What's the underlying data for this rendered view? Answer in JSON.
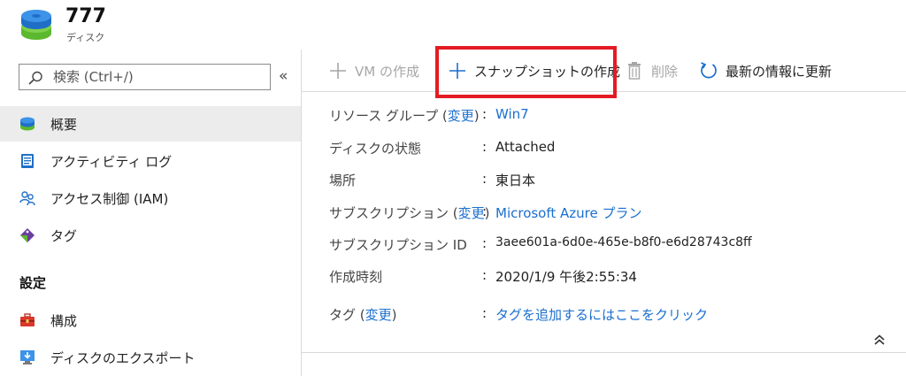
{
  "resource": {
    "title": "777",
    "subtitle": "ディスク"
  },
  "search": {
    "placeholder": "検索 (Ctrl+/)",
    "collapse_symbol": "«"
  },
  "sidebar": {
    "items": [
      {
        "label": "概要",
        "icon": "disk-icon"
      },
      {
        "label": "アクティビティ ログ",
        "icon": "activity-log-icon"
      },
      {
        "label": "アクセス制御 (IAM)",
        "icon": "people-icon"
      },
      {
        "label": "タグ",
        "icon": "tag-icon"
      }
    ],
    "section_title": "設定",
    "settings_items": [
      {
        "label": "構成",
        "icon": "toolbox-icon"
      },
      {
        "label": "ディスクのエクスポート",
        "icon": "export-monitor-icon"
      }
    ]
  },
  "toolbar": {
    "create_vm": "VM の作成",
    "create_snapshot": "スナップショットの作成",
    "delete": "削除",
    "refresh": "最新の情報に更新"
  },
  "properties": {
    "resource_group": {
      "label": "リソース グループ",
      "change": "変更",
      "value": "Win7"
    },
    "disk_state": {
      "label": "ディスクの状態",
      "value": "Attached"
    },
    "location": {
      "label": "場所",
      "value": "東日本"
    },
    "subscription": {
      "label": "サブスクリプション",
      "change": "変更",
      "value": "Microsoft Azure プラン"
    },
    "subscription_id": {
      "label": "サブスクリプション ID",
      "value": "3aee601a-6d0e-465e-b8f0-e6d28743c8ff"
    },
    "created": {
      "label": "作成時刻",
      "value": "2020/1/9 午後2:55:34"
    },
    "tags": {
      "label": "タグ",
      "change": "変更",
      "value": "タグを追加するにはここをクリック"
    }
  },
  "colors": {
    "accent_link": "#1a6fcf",
    "highlight_border": "#e31b23",
    "active_nav_bg": "#ececec"
  }
}
